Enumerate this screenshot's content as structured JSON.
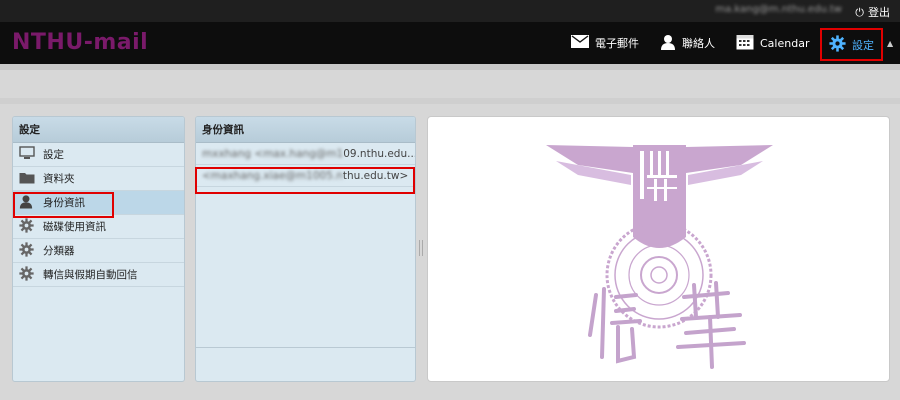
{
  "topbar": {
    "user_email": "ma.kang@m.nthu.edu.tw",
    "logout_label": "登出"
  },
  "header": {
    "logo": "NTHU-mail",
    "nav": {
      "mail_label": "電子郵件",
      "contacts_label": "聯絡人",
      "calendar_label": "Calendar",
      "settings_label": "設定"
    }
  },
  "settings_panel": {
    "title": "設定",
    "items": [
      {
        "label": "設定",
        "icon": "monitor-icon"
      },
      {
        "label": "資料夾",
        "icon": "folder-icon"
      },
      {
        "label": "身份資訊",
        "icon": "person-icon",
        "active": true
      },
      {
        "label": "磁碟使用資訊",
        "icon": "gear-icon"
      },
      {
        "label": "分類器",
        "icon": "gear-icon"
      },
      {
        "label": "轉信與假期自動回信",
        "icon": "gear-icon"
      }
    ]
  },
  "identity_panel": {
    "title": "身份資訊",
    "rows": [
      {
        "prefix": "mxxhang <max.hang@m1",
        "suffix": "09.nthu.edu...."
      },
      {
        "prefix": "<maxhang.xiae@m1005.n",
        "suffix": "thu.edu.tw>"
      }
    ]
  },
  "colors": {
    "accent_settings": "#4fb3ff",
    "logo": "#7a1a6a",
    "highlight_box": "#e00000",
    "emblem": "#c9a6cf"
  }
}
